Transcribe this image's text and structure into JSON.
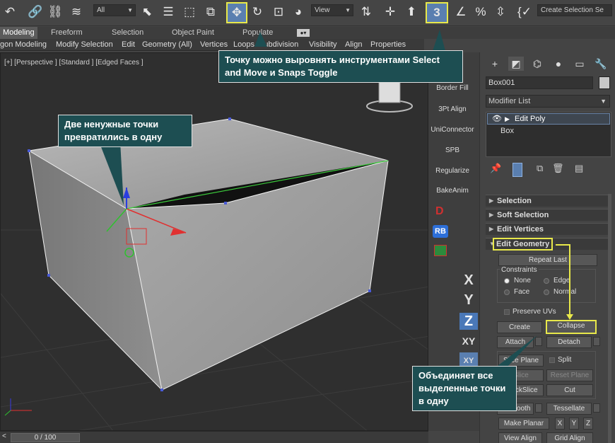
{
  "toolbar": {
    "filter_dropdown": "All",
    "view_dropdown": "View",
    "selection_set": "Create Selection Se",
    "icons": [
      "undo-icon",
      "link-icon",
      "unlink-icon",
      "bind-spacewarp-icon",
      "select-icon",
      "select-by-name-icon",
      "rect-selection-icon",
      "window-crossing-icon",
      "select-and-move-icon",
      "rotate-icon",
      "scale-icon",
      "placement-icon",
      "use-pivot-icon",
      "select-manipulate-icon",
      "keyboard-shortcut-icon",
      "snaps-toggle-icon",
      "angle-snap-icon",
      "percent-snap-icon",
      "spinner-snap-icon",
      "edit-named-sets-icon"
    ],
    "snaps_label": "3"
  },
  "ribbon": {
    "tabs": [
      "Modeling",
      "Freeform",
      "Selection",
      "Object Paint",
      "Populate"
    ],
    "active_tab": "Modeling",
    "panels": [
      "gon Modeling",
      "Modify Selection",
      "Edit",
      "Geometry (All)",
      "Vertices",
      "Loops",
      "Subdivision",
      "Visibility",
      "Align",
      "Properties"
    ]
  },
  "viewport": {
    "label": "[+] [Perspective ] [Standard ] [Edged Faces ]"
  },
  "strip": {
    "buttons": [
      "Border Fill",
      "3Pt Align",
      "UniConnector",
      "SPB",
      "Regularize",
      "BakeAnim"
    ],
    "rb_label": "RB",
    "d_label": "D",
    "axes": [
      "X",
      "Y",
      "Z",
      "XY",
      "XY"
    ]
  },
  "command_panel": {
    "object_name": "Box001",
    "modifier_list": "Modifier List",
    "stack": [
      "Edit Poly",
      "Box"
    ],
    "rollouts": [
      "Selection",
      "Soft Selection",
      "Edit Vertices",
      "Edit Geometry"
    ],
    "edit_geometry": {
      "repeat_last": "Repeat Last",
      "constraints_label": "Constraints",
      "constraints": [
        "None",
        "Edge",
        "Face",
        "Normal"
      ],
      "selected_constraint": "None",
      "preserve_uvs": "Preserve UVs",
      "create": "Create",
      "collapse": "Collapse",
      "attach": "Attach",
      "detach": "Detach",
      "slice_plane": "Slice Plane",
      "split": "Split",
      "slice": "Slice",
      "reset_plane": "Reset Plane",
      "quickslice": "QuickSlice",
      "cut": "Cut",
      "msmooth": "MSmooth",
      "tessellate": "Tessellate",
      "make_planar": "Make Planar",
      "x": "X",
      "y": "Y",
      "z": "Z",
      "view_align": "View Align",
      "grid_align": "Grid Align"
    }
  },
  "timeline": {
    "frame": "0 / 100"
  },
  "callouts": {
    "top": "Точку можно выровнять инструментами Select and Move и Snaps Toggle",
    "left": "Две ненужные точки превратились в одну",
    "bottom": "Объединяет все выделенные точки в одну"
  }
}
